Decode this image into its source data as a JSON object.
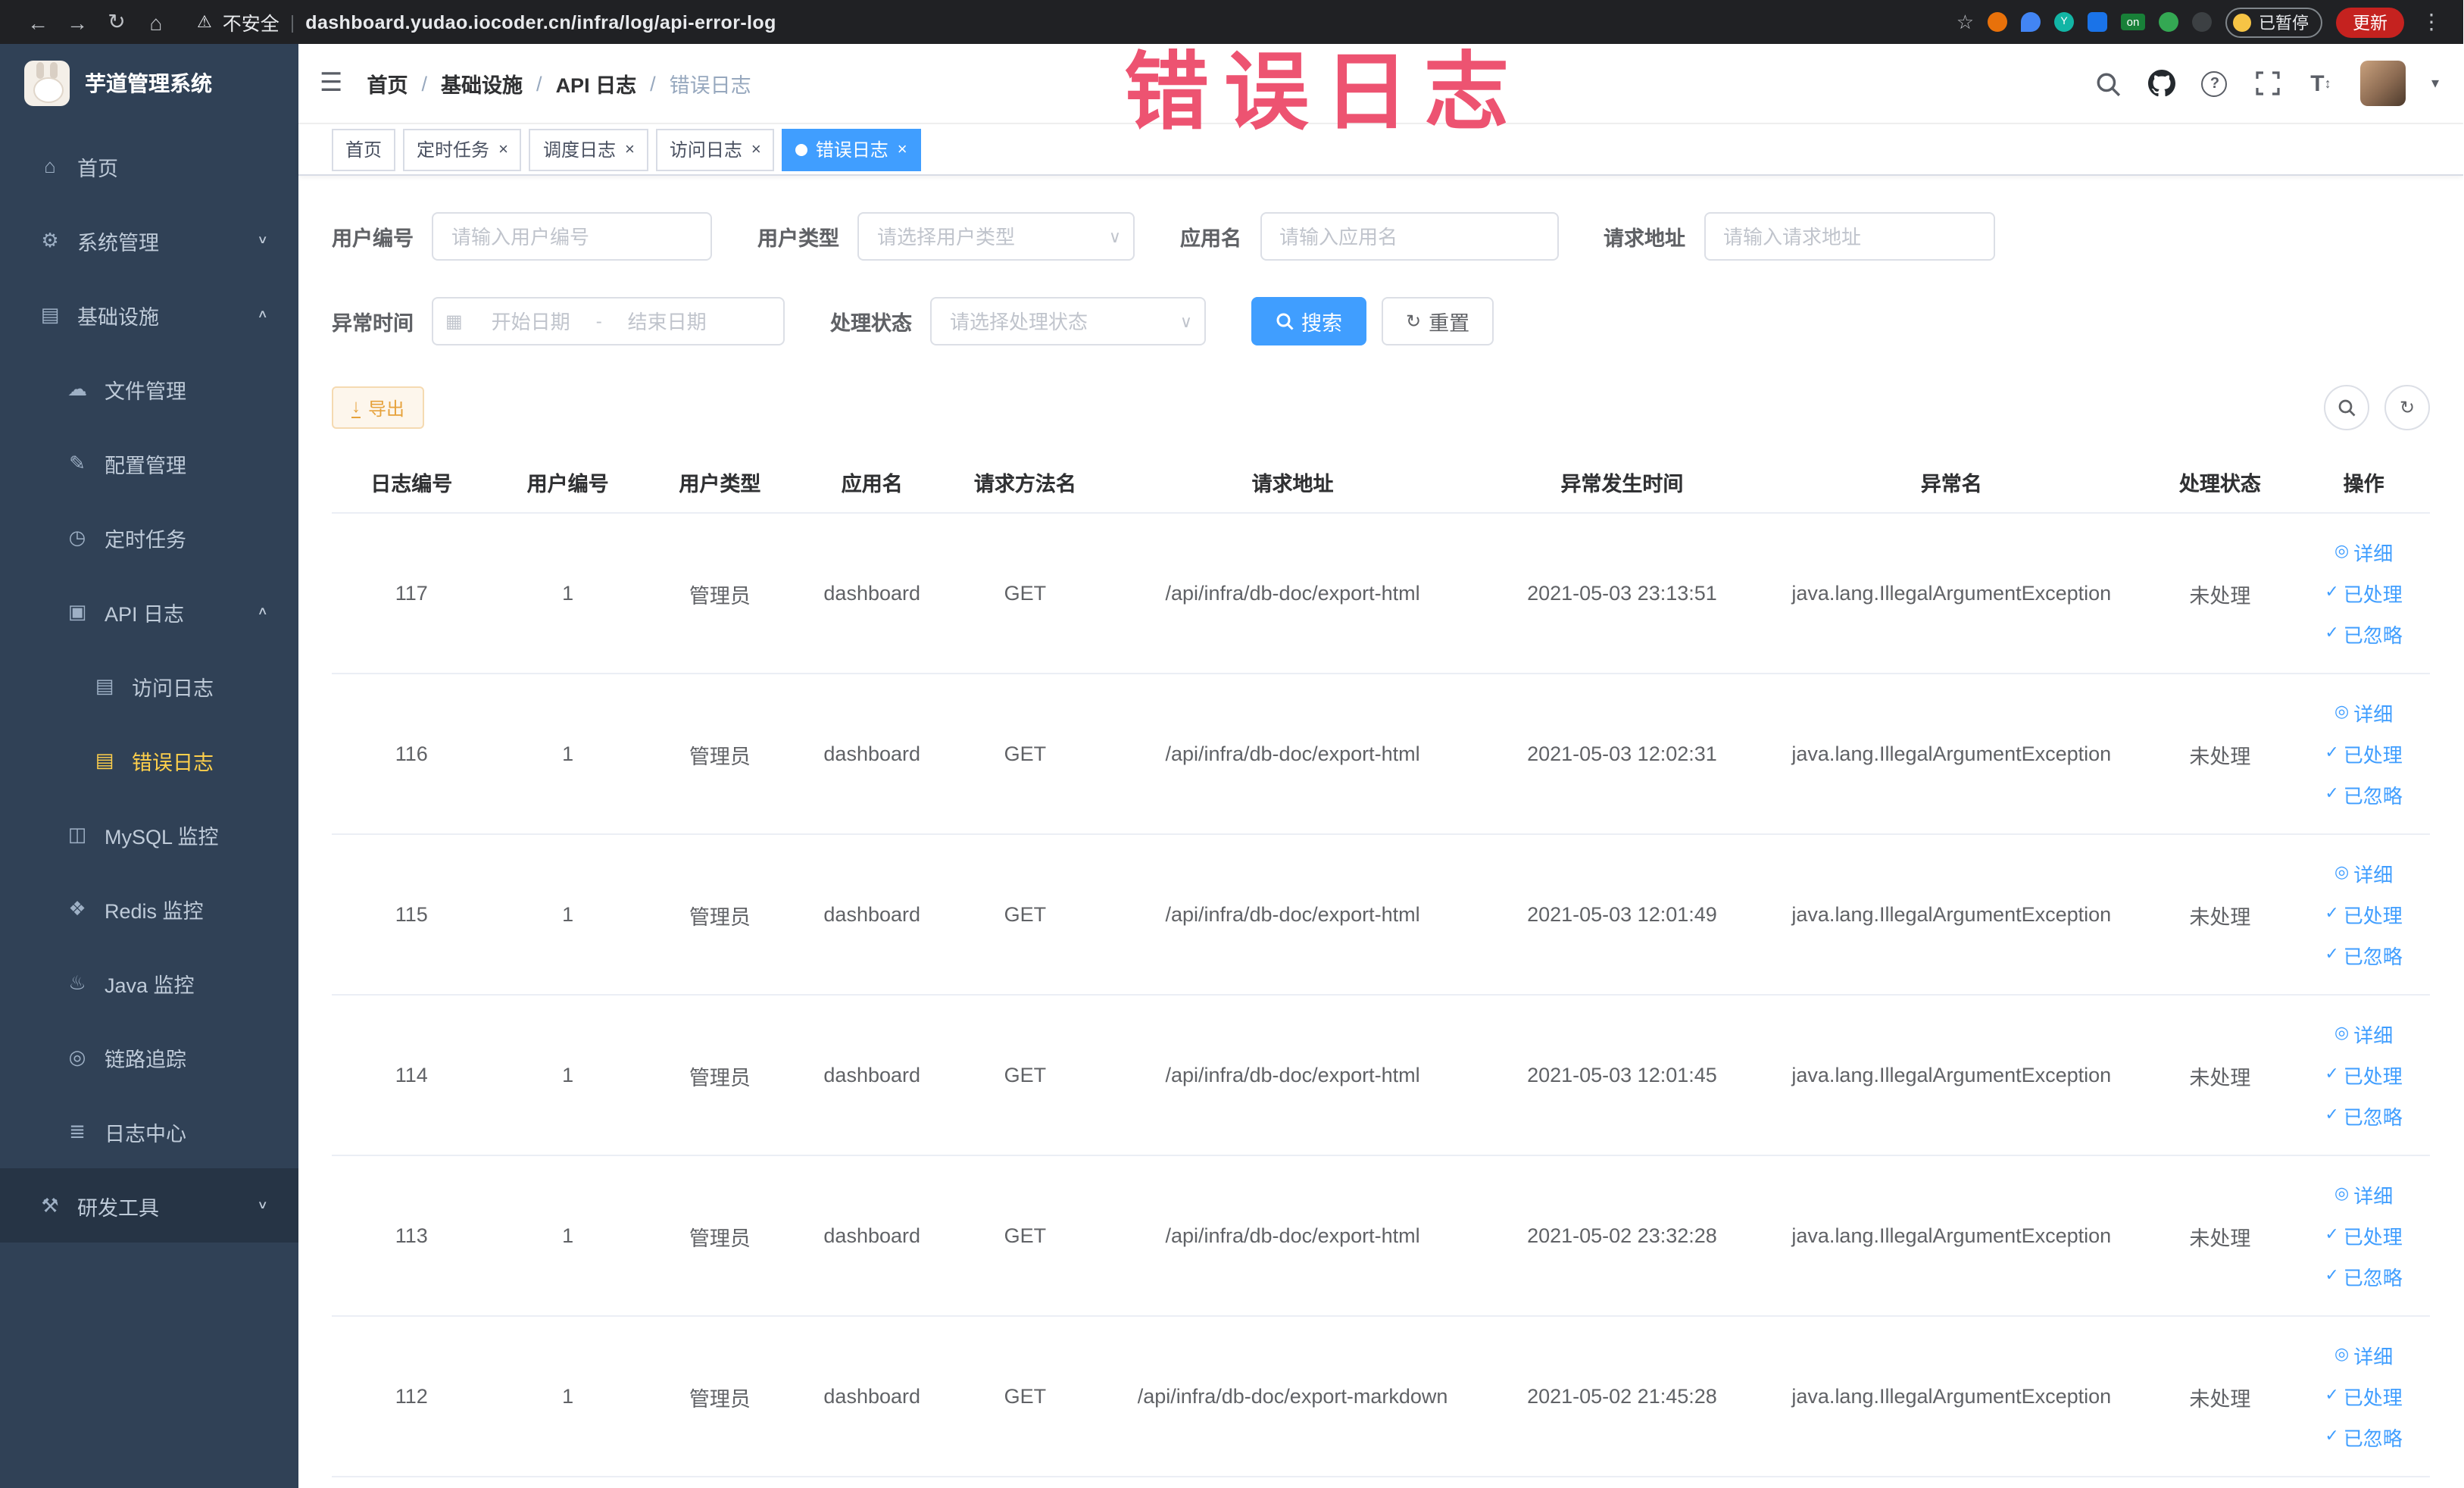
{
  "browser": {
    "security_label": "不安全",
    "url": "dashboard.yudao.iocoder.cn/infra/log/api-error-log",
    "paused_badge": "已暂停",
    "update_button": "更新",
    "on_badge": "on"
  },
  "stamp": "错误日志",
  "icons": {
    "back": "←",
    "forward": "→",
    "reload": "↻",
    "home": "⌂",
    "warning": "⚠",
    "star": "☆",
    "more": "⋮",
    "hamburger": "☰",
    "close": "×",
    "chevron_down": "∨",
    "chevron_up": "∧",
    "caret_down": "▾",
    "calendar": "▦",
    "check": "✓",
    "view": "◎",
    "refresh": "↻",
    "download": "↓",
    "question": "?",
    "font_size": "T",
    "updown": "↕"
  },
  "sidebar": {
    "logo_title": "芋道管理系统",
    "items": [
      {
        "label": "首页",
        "glyph": "⌂"
      },
      {
        "label": "系统管理",
        "glyph": "⚙"
      },
      {
        "label": "基础设施",
        "glyph": "▤"
      },
      {
        "label": "文件管理",
        "glyph": "☁"
      },
      {
        "label": "配置管理",
        "glyph": "✎"
      },
      {
        "label": "定时任务",
        "glyph": "◷"
      },
      {
        "label": "API 日志",
        "glyph": "▣"
      },
      {
        "label": "访问日志",
        "glyph": "▤"
      },
      {
        "label": "错误日志",
        "glyph": "▤"
      },
      {
        "label": "MySQL 监控",
        "glyph": "◫"
      },
      {
        "label": "Redis 监控",
        "glyph": "❖"
      },
      {
        "label": "Java 监控",
        "glyph": "♨"
      },
      {
        "label": "链路追踪",
        "glyph": "◎"
      },
      {
        "label": "日志中心",
        "glyph": "≣"
      },
      {
        "label": "研发工具",
        "glyph": "⚒"
      }
    ]
  },
  "header": {
    "breadcrumb": [
      "首页",
      "基础设施",
      "API 日志",
      "错误日志"
    ],
    "separator": "/"
  },
  "tabs": [
    {
      "label": "首页"
    },
    {
      "label": "定时任务"
    },
    {
      "label": "调度日志"
    },
    {
      "label": "访问日志"
    },
    {
      "label": "错误日志"
    }
  ],
  "filters": {
    "user_id": {
      "label": "用户编号",
      "placeholder": "请输入用户编号"
    },
    "user_type": {
      "label": "用户类型",
      "placeholder": "请选择用户类型"
    },
    "app_name": {
      "label": "应用名",
      "placeholder": "请输入应用名"
    },
    "request_url": {
      "label": "请求地址",
      "placeholder": "请输入请求地址"
    },
    "exception_time": {
      "label": "异常时间",
      "start_placeholder": "开始日期",
      "separator": "-",
      "end_placeholder": "结束日期"
    },
    "process_status": {
      "label": "处理状态",
      "placeholder": "请选择处理状态"
    },
    "search_button": "搜索",
    "reset_button": "重置"
  },
  "toolbar": {
    "export_button": "导出"
  },
  "table": {
    "headers": [
      "日志编号",
      "用户编号",
      "用户类型",
      "应用名",
      "请求方法名",
      "请求地址",
      "异常发生时间",
      "异常名",
      "处理状态",
      "操作"
    ],
    "row_actions": [
      "详细",
      "已处理",
      "已忽略"
    ],
    "rows": [
      {
        "id": "117",
        "user_id": "1",
        "user_type": "管理员",
        "app_name": "dashboard",
        "method": "GET",
        "url": "/api/infra/db-doc/export-html",
        "time": "2021-05-03 23:13:51",
        "exception": "java.lang.IllegalArgumentException",
        "status": "未处理"
      },
      {
        "id": "116",
        "user_id": "1",
        "user_type": "管理员",
        "app_name": "dashboard",
        "method": "GET",
        "url": "/api/infra/db-doc/export-html",
        "time": "2021-05-03 12:02:31",
        "exception": "java.lang.IllegalArgumentException",
        "status": "未处理"
      },
      {
        "id": "115",
        "user_id": "1",
        "user_type": "管理员",
        "app_name": "dashboard",
        "method": "GET",
        "url": "/api/infra/db-doc/export-html",
        "time": "2021-05-03 12:01:49",
        "exception": "java.lang.IllegalArgumentException",
        "status": "未处理"
      },
      {
        "id": "114",
        "user_id": "1",
        "user_type": "管理员",
        "app_name": "dashboard",
        "method": "GET",
        "url": "/api/infra/db-doc/export-html",
        "time": "2021-05-03 12:01:45",
        "exception": "java.lang.IllegalArgumentException",
        "status": "未处理"
      },
      {
        "id": "113",
        "user_id": "1",
        "user_type": "管理员",
        "app_name": "dashboard",
        "method": "GET",
        "url": "/api/infra/db-doc/export-html",
        "time": "2021-05-02 23:32:28",
        "exception": "java.lang.IllegalArgumentException",
        "status": "未处理"
      },
      {
        "id": "112",
        "user_id": "1",
        "user_type": "管理员",
        "app_name": "dashboard",
        "method": "GET",
        "url": "/api/infra/db-doc/export-markdown",
        "time": "2021-05-02 21:45:28",
        "exception": "java.lang.IllegalArgumentException",
        "status": "未处理"
      }
    ]
  }
}
